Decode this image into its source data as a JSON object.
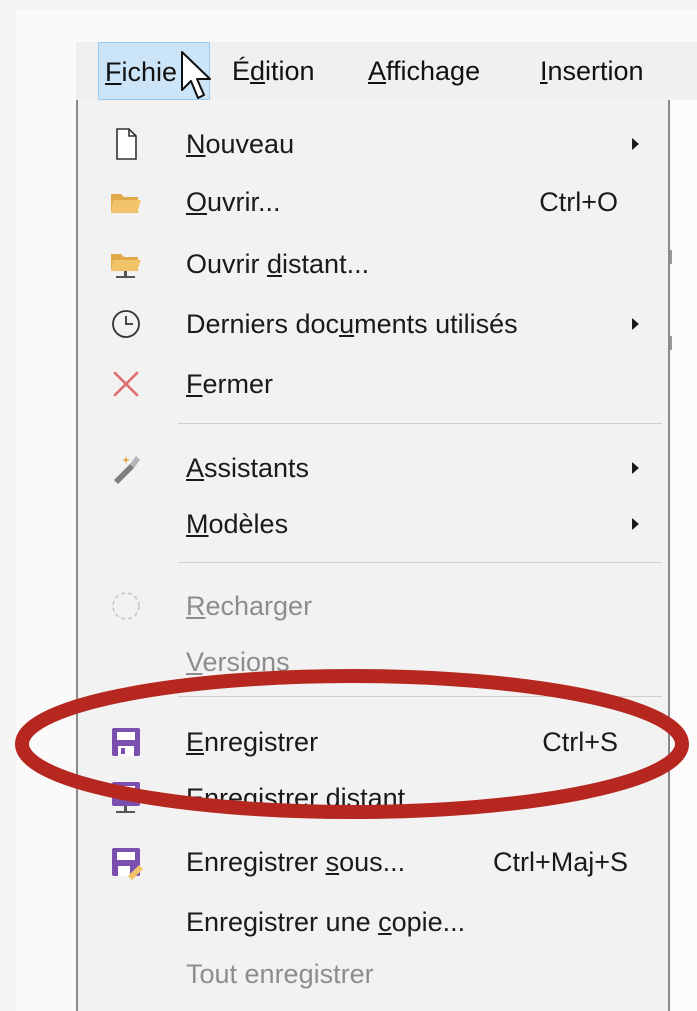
{
  "menubar": {
    "items": [
      {
        "label": "Fichier",
        "mnemonic": "F",
        "active": true
      },
      {
        "label": "Édition",
        "mnemonic": "d"
      },
      {
        "label": "Affichage",
        "mnemonic": "A"
      },
      {
        "label": "Insertion",
        "mnemonic": "I"
      }
    ]
  },
  "file_menu": {
    "items": [
      {
        "label_pre": "",
        "label_key": "N",
        "label_post": "ouveau",
        "icon": "new-document-icon",
        "submenu": true
      },
      {
        "label_pre": "",
        "label_key": "O",
        "label_post": "uvrir...",
        "shortcut": "Ctrl+O",
        "icon": "open-folder-icon"
      },
      {
        "label_pre": "Ouvrir ",
        "label_key": "d",
        "label_post": "istant...",
        "icon": "open-remote-folder-icon"
      },
      {
        "label_pre": "Derniers doc",
        "label_key": "u",
        "label_post": "ments utilisés",
        "icon": "clock-icon",
        "submenu": true
      },
      {
        "label_pre": "",
        "label_key": "F",
        "label_post": "ermer",
        "icon": "close-x-icon"
      },
      {
        "label_pre": "",
        "label_key": "A",
        "label_post": "ssistants",
        "icon": "wizard-wand-icon",
        "submenu": true
      },
      {
        "label_pre": "",
        "label_key": "M",
        "label_post": "odèles",
        "submenu": true
      },
      {
        "label_pre": "",
        "label_key": "R",
        "label_post": "echarger",
        "icon": "reload-icon",
        "disabled": true
      },
      {
        "label_pre": "",
        "label_key": "V",
        "label_post": "ersions",
        "disabled": true
      },
      {
        "label_pre": "",
        "label_key": "E",
        "label_post": "nregistrer",
        "shortcut": "Ctrl+S",
        "icon": "save-floppy-icon"
      },
      {
        "label_pre": "E",
        "label_key": "n",
        "label_post": "registrer distant...",
        "icon": "save-remote-icon"
      },
      {
        "label_pre": "Enregistrer ",
        "label_key": "s",
        "label_post": "ous...",
        "shortcut": "Ctrl+Maj+S",
        "icon": "save-as-icon"
      },
      {
        "label_pre": "Enregistrer une ",
        "label_key": "c",
        "label_post": "opie..."
      },
      {
        "label_pre": "Tout enregistrer",
        "label_key": "",
        "label_post": "",
        "disabled": true
      }
    ]
  },
  "colors": {
    "annotation_ellipse": "#b5271f",
    "floppy_purple": "#7b4fb0",
    "folder_yellow": "#f2c46a",
    "close_x": "#e06c6c"
  }
}
